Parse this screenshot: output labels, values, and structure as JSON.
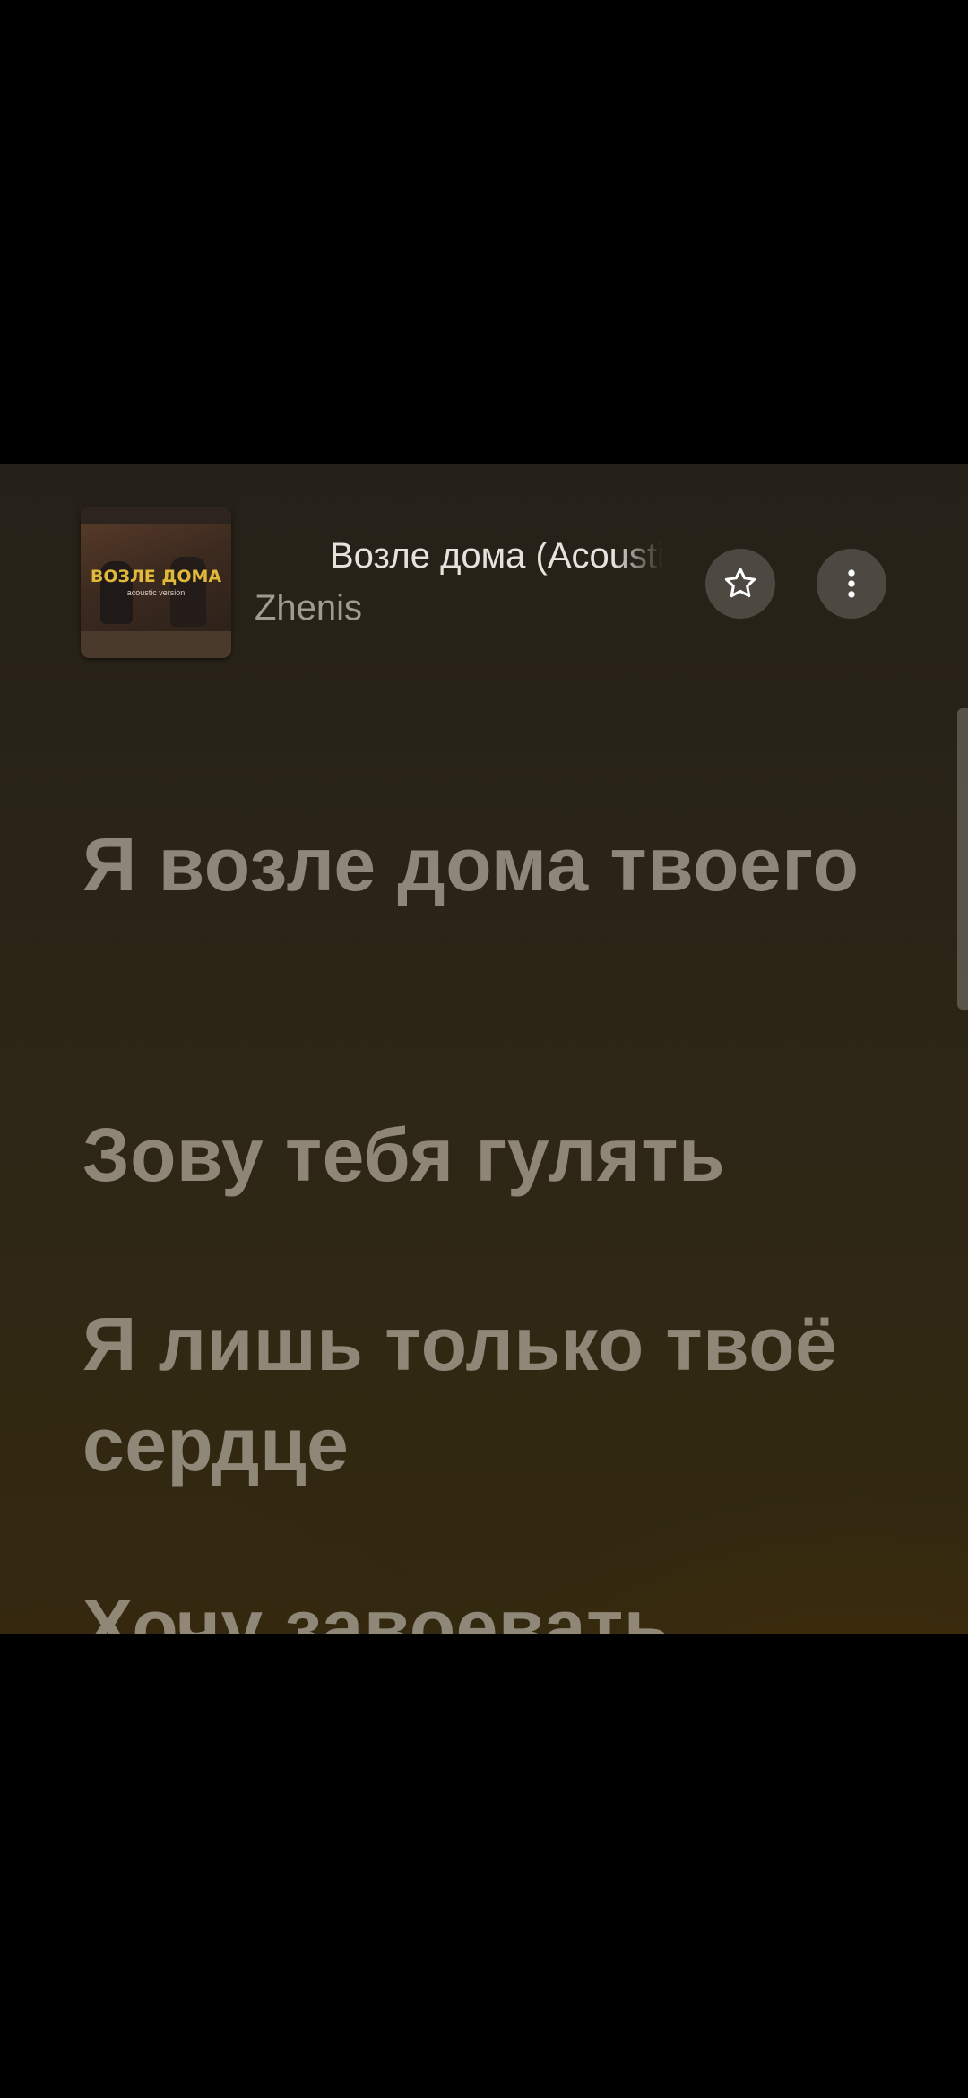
{
  "player": {
    "album_art": {
      "title": "ВОЗЛЕ ДОМА",
      "subtitle": "acoustic version"
    },
    "song_title": "Возле дома (Acoustic Version)",
    "artist": "Zhenis",
    "favorite_icon": "star-outline-icon",
    "more_icon": "vertical-ellipsis-icon"
  },
  "lyrics": {
    "lines": [
      "Я возле дома твоего",
      "Зову тебя гулять",
      "Я лишь только твоё сердце",
      "Хочу завоевать"
    ]
  },
  "colors": {
    "background_top": "#252119",
    "background_bottom": "#33290f",
    "lyric_text": "#a0988a",
    "title_text": "#e6e3de",
    "artist_text": "#a09a92"
  }
}
